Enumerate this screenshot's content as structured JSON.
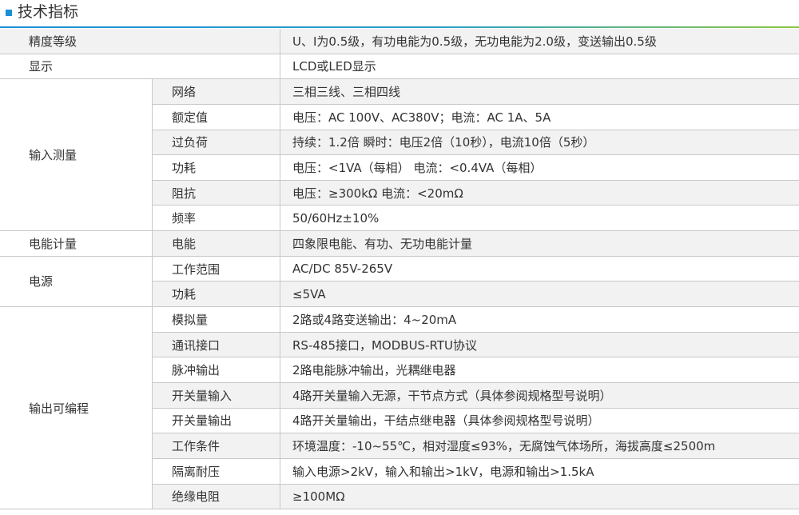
{
  "header": {
    "title": "技术指标"
  },
  "rows": [
    {
      "c1": "精度等级",
      "c2": "",
      "c3": "U、I为0.5级，有功电能为0.5级，无功电能为2.0级，变送输出0.5级"
    },
    {
      "c1": "显示",
      "c2": "",
      "c3": "LCD或LED显示"
    },
    {
      "c1": "",
      "c2": "网络",
      "c3": "三相三线、三相四线"
    },
    {
      "c1": "",
      "c2": "额定值",
      "c3": "电压：AC 100V、AC380V；电流：AC 1A、5A"
    },
    {
      "c1": "",
      "c2": "过负荷",
      "c3": "持续：1.2倍  瞬时：电压2倍（10秒），电流10倍（5秒）"
    },
    {
      "c1": "",
      "c2": "功耗",
      "c3": "电压：<1VA（每相） 电流：<0.4VA（每相）"
    },
    {
      "c1": "",
      "c2": "阻抗",
      "c3": "电压：≥300kΩ   电流：<20mΩ"
    },
    {
      "c1": "",
      "c2": "频率",
      "c3": "50/60Hz±10%"
    },
    {
      "c1": "",
      "c2": "电能",
      "c3": "四象限电能、有功、无功电能计量"
    },
    {
      "c1": "",
      "c2": "工作范围",
      "c3": "AC/DC 85V-265V"
    },
    {
      "c1": "",
      "c2": "功耗",
      "c3": "≤5VA"
    },
    {
      "c1": "",
      "c2": "模拟量",
      "c3": "2路或4路变送输出：4~20mA"
    },
    {
      "c1": "",
      "c2": "通讯接口",
      "c3": "RS-485接口，MODBUS-RTU协议"
    },
    {
      "c1": "",
      "c2": "脉冲输出",
      "c3": "2路电能脉冲输出，光耦继电器"
    },
    {
      "c1": "",
      "c2": "开关量输入",
      "c3": "4路开关量输入无源，干节点方式（具体参阅规格型号说明）"
    },
    {
      "c1": "",
      "c2": "开关量输出",
      "c3": "4路开关量输出，干结点继电器（具体参阅规格型号说明）"
    },
    {
      "c1": "",
      "c2": "工作条件",
      "c3": "环境温度：-10~55℃，相对湿度≤93%，无腐蚀气体场所，海拔高度≤2500m"
    },
    {
      "c1": "",
      "c2": "隔离耐压",
      "c3": "输入电源>2kV，输入和输出>1kV，电源和输出>1.5kA"
    },
    {
      "c1": "",
      "c2": "绝缘电阻",
      "c3": "≥100MΩ"
    }
  ],
  "groups": [
    {
      "label": "输入测量",
      "start": 2,
      "span": 6
    },
    {
      "label": "电能计量",
      "start": 8,
      "span": 1
    },
    {
      "label": "电源",
      "start": 9,
      "span": 2
    },
    {
      "label": "输出可编程",
      "start": 11,
      "span": 8
    }
  ],
  "colors": {
    "accent": "#1a8fd6",
    "gradient_end": "#8cc63f",
    "row_shade": "#f2f2f2",
    "border": "#c8c8c8"
  }
}
